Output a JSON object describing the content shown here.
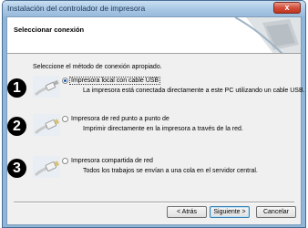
{
  "window": {
    "title": "Instalación del controlador de impresora",
    "close_symbol": "x"
  },
  "header": {
    "title": "Seleccionar conexión",
    "graphic_icon": "printer-wizard-graphic"
  },
  "intro": "Seleccione el método de conexión apropiado.",
  "options": [
    {
      "number": "1",
      "icon": "usb-cable-icon",
      "label": "Impresora local con cable USB",
      "description": "La impresora está conectada directamente a este PC utilizando un cable USB.",
      "selected": true
    },
    {
      "number": "2",
      "icon": "network-cable-icon",
      "label": "Impresora de red punto a punto de",
      "description": "Imprimir directamente en la impresora a través de la red.",
      "selected": false
    },
    {
      "number": "3",
      "icon": "network-cable-icon",
      "label": "Impresora compartida de red",
      "description": "Todos los trabajos se envían a una cola en el servidor central.",
      "selected": false
    }
  ],
  "buttons": {
    "back": "< Atrás",
    "next": "Siguiente >",
    "cancel": "Cancelar"
  },
  "colors": {
    "frame": "#8fb6d8",
    "close": "#c0341f",
    "radio_selected": "#1c5aa6"
  }
}
